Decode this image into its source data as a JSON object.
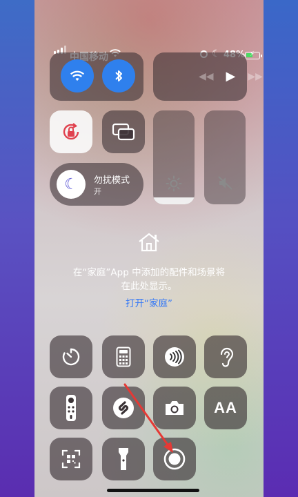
{
  "status": {
    "carrier": "中国移动",
    "battery_percent": "48%"
  },
  "focus": {
    "title": "勿扰模式",
    "subtitle": "开"
  },
  "home": {
    "message_line1": "在“家庭”App 中添加的配件和场景将",
    "message_line2": "在此处显示。",
    "link_label": "打开“家庭”"
  },
  "icons": {
    "wifi": "wifi-icon",
    "bluetooth": "bluetooth-icon",
    "orientation_lock": "orientation-lock-icon",
    "screen_mirroring": "screen-mirroring-icon",
    "brightness": "brightness-icon",
    "mute": "speaker-mute-icon",
    "timer": "timer-icon",
    "calculator": "calculator-icon",
    "nfc": "nfc-icon",
    "hearing": "hearing-icon",
    "remote": "remote-icon",
    "shazam": "shazam-icon",
    "camera": "camera-icon",
    "text_size": "text-size-icon",
    "qr_scanner": "qr-scanner-icon",
    "flashlight": "flashlight-icon",
    "screen_recording": "screen-recording-icon"
  },
  "levels": {
    "brightness": 0.07,
    "volume": 0.0
  },
  "text_size_label": "AA",
  "colors": {
    "accent_blue": "#2f80ed",
    "battery_green": "#4cd964",
    "annotation_red": "#e53935"
  }
}
